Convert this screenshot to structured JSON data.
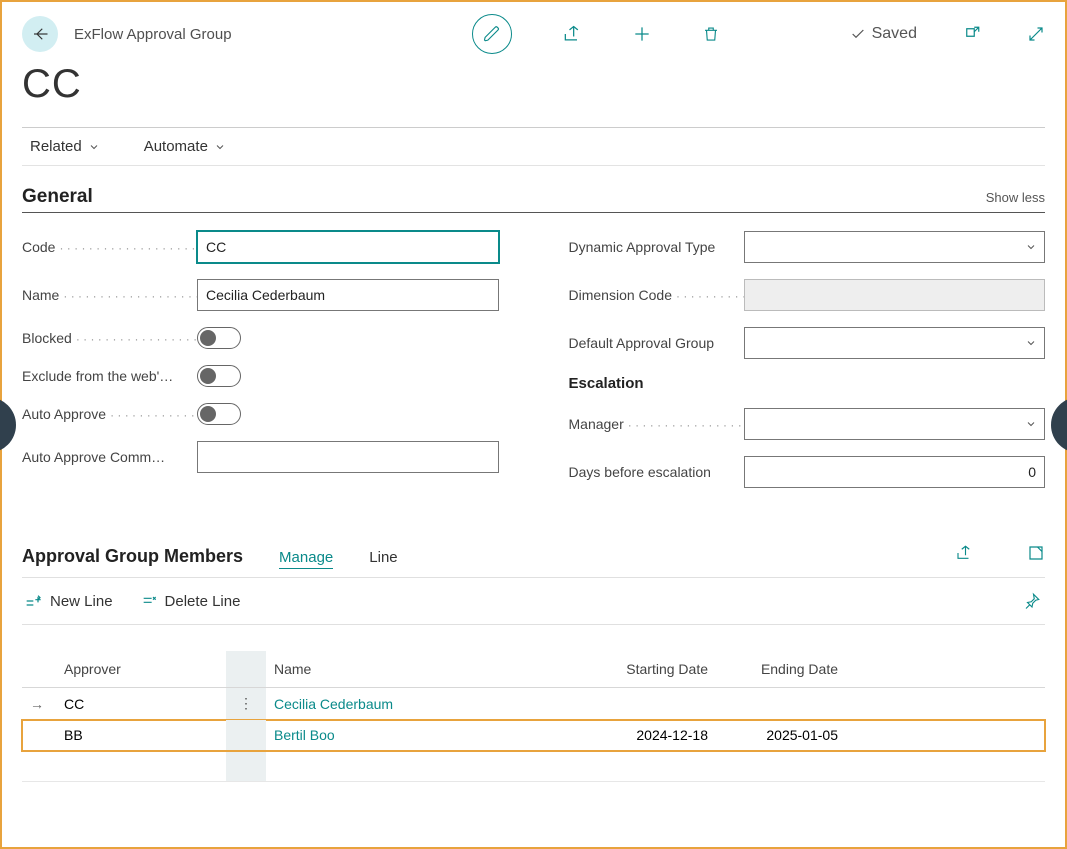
{
  "header": {
    "module": "ExFlow Approval Group",
    "saved": "Saved"
  },
  "title": "CC",
  "menubar": {
    "related": "Related",
    "automate": "Automate"
  },
  "general": {
    "heading": "General",
    "show_less": "Show less",
    "labels": {
      "code": "Code",
      "name": "Name",
      "blocked": "Blocked",
      "exclude": "Exclude from the web'…",
      "auto_approve": "Auto Approve",
      "auto_approve_comm": "Auto Approve Comm…",
      "dyn_type": "Dynamic Approval Type",
      "dim_code": "Dimension Code",
      "def_group": "Default Approval Group",
      "escalation": "Escalation",
      "manager": "Manager",
      "days_before": "Days before escalation"
    },
    "values": {
      "code": "CC",
      "name": "Cecilia Cederbaum",
      "dyn_type": "",
      "dim_code": "",
      "def_group": "",
      "manager": "",
      "days_before": "0",
      "auto_approve_comm": ""
    }
  },
  "members": {
    "heading": "Approval Group Members",
    "tabs": {
      "manage": "Manage",
      "line": "Line"
    },
    "toolbar": {
      "new_line": "New Line",
      "delete_line": "Delete Line"
    },
    "columns": {
      "approver": "Approver",
      "name": "Name",
      "start": "Starting Date",
      "end": "Ending Date"
    },
    "rows": [
      {
        "approver": "CC",
        "name": "Cecilia Cederbaum",
        "start": "",
        "end": "",
        "current": true
      },
      {
        "approver": "BB",
        "name": "Bertil Boo",
        "start": "2024-12-18",
        "end": "2025-01-05",
        "highlight": true
      }
    ]
  }
}
